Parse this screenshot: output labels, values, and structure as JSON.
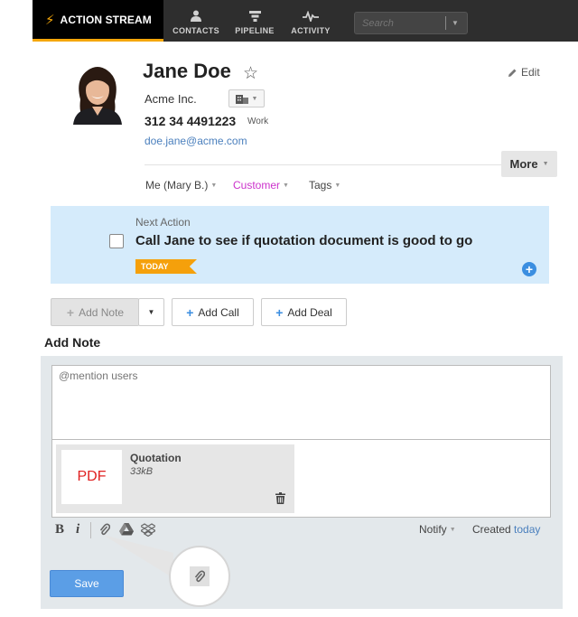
{
  "nav": {
    "action_stream": "ACTION STREAM",
    "contacts": "CONTACTS",
    "pipeline": "PIPELINE",
    "activity": "ACTIVITY",
    "search_placeholder": "Search"
  },
  "contact": {
    "name": "Jane Doe",
    "company": "Acme Inc.",
    "phone": "312 34 4491223",
    "phone_type": "Work",
    "email": "doe.jane@acme.com",
    "edit_label": "Edit",
    "more_label": "More",
    "owner": "Me (Mary B.)",
    "status": "Customer",
    "tags": "Tags",
    "status_color": "#cc33cc"
  },
  "next_action": {
    "label": "Next Action",
    "text": "Call Jane to see if quotation document is good to go",
    "badge": "TODAY"
  },
  "actions": {
    "add_note": "Add Note",
    "add_call": "Add Call",
    "add_deal": "Add Deal"
  },
  "note": {
    "title": "Add Note",
    "placeholder": "@mention users",
    "attachment": {
      "thumb": "PDF",
      "name": "Quotation",
      "size": "33kB"
    },
    "bold": "B",
    "italic": "i",
    "notify": "Notify",
    "created_label": "Created",
    "created_value": "today",
    "save": "Save"
  },
  "colors": {
    "accent": "#f5a70a",
    "link": "#4a7fbd",
    "save": "#5b9ee6"
  }
}
